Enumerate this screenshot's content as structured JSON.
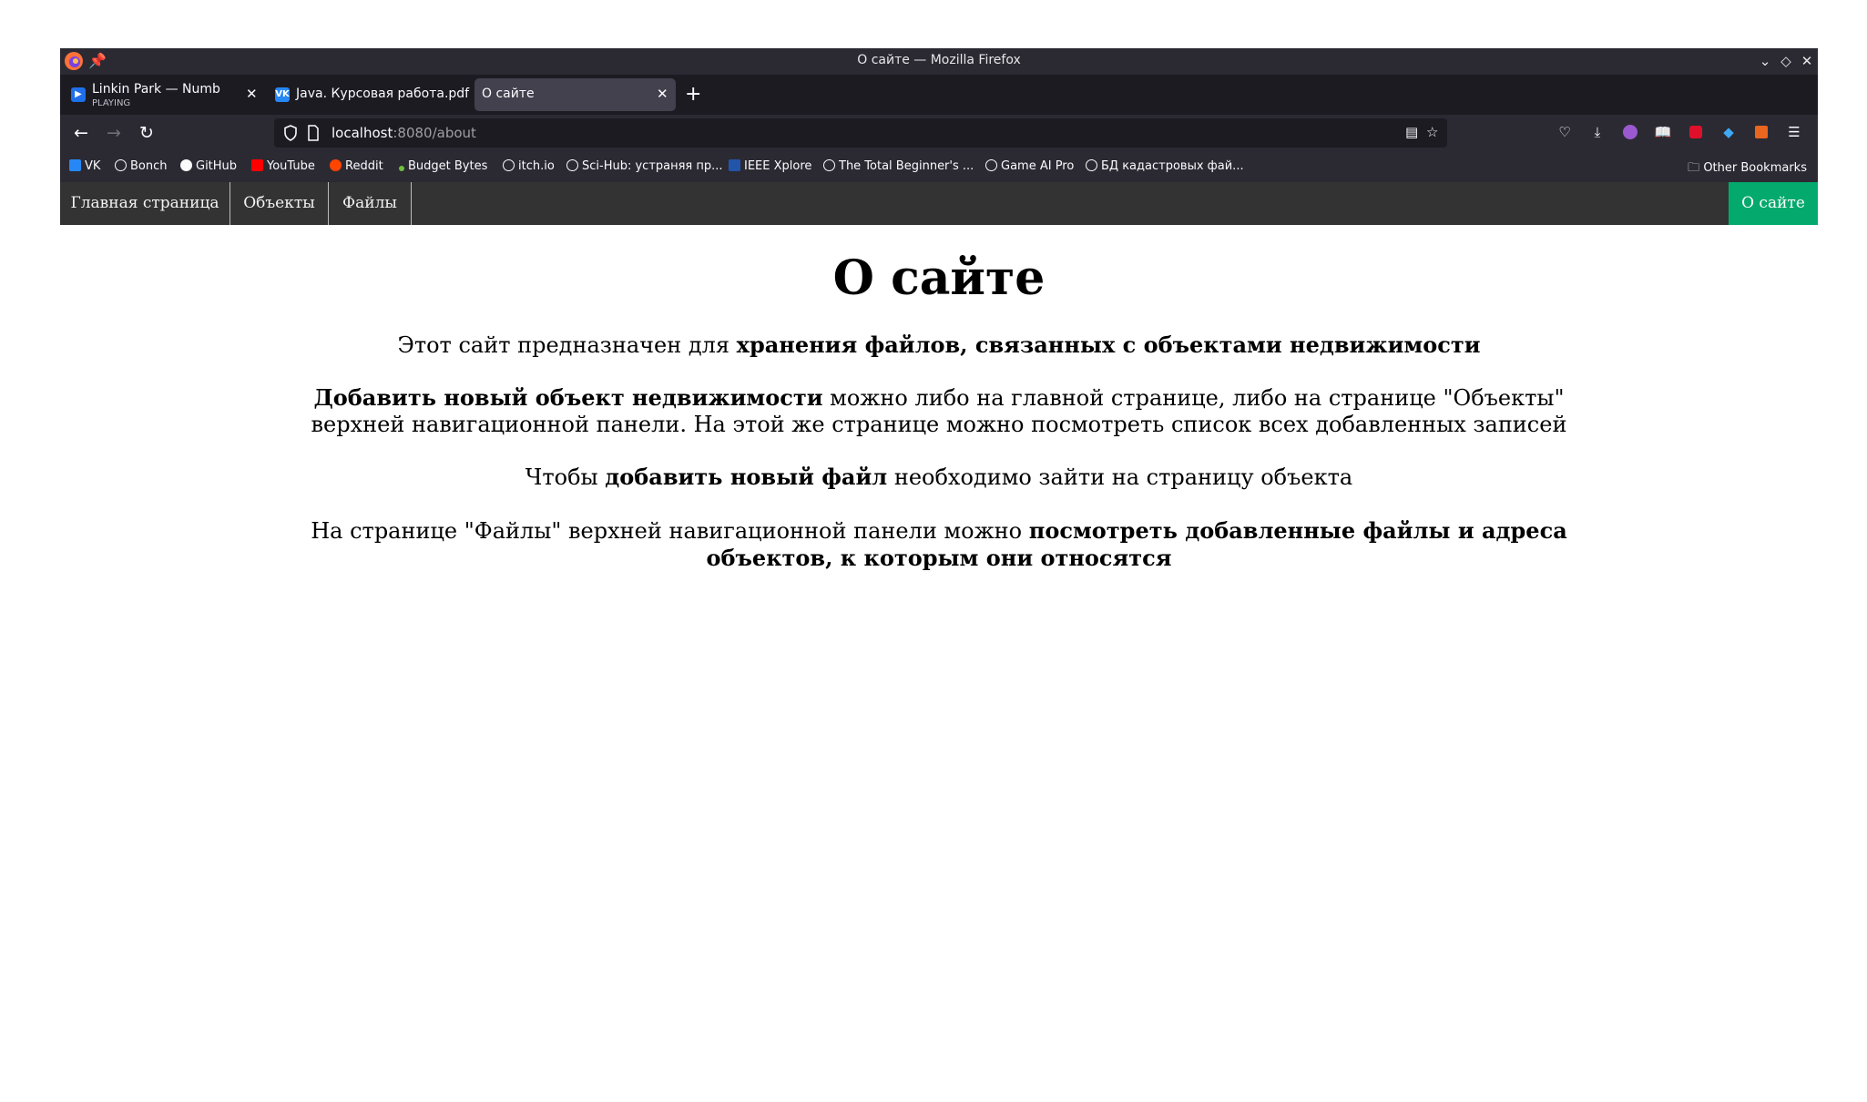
{
  "window": {
    "title": "О сайте — Mozilla Firefox"
  },
  "tabs": [
    {
      "label": "Linkin Park — Numb",
      "sub": "PLAYING"
    },
    {
      "label": "Java. Курсовая работа.pdf"
    },
    {
      "label": "О сайте"
    }
  ],
  "navbar": {
    "url_host": "localhost",
    "url_path": ":8080/about"
  },
  "bookmarks": [
    {
      "label": "VK",
      "icon": "vk-icon",
      "color": "#2787f5"
    },
    {
      "label": "Bonch",
      "icon": "globe-icon"
    },
    {
      "label": "GitHub",
      "icon": "github-icon"
    },
    {
      "label": "YouTube",
      "icon": "youtube-icon",
      "color": "#ff0000"
    },
    {
      "label": "Reddit",
      "icon": "reddit-icon",
      "color": "#ff4500"
    },
    {
      "label": "Budget Bytes",
      "icon": "budget-bytes-icon"
    },
    {
      "label": "itch.io",
      "icon": "globe-icon"
    },
    {
      "label": "Sci-Hub: устраняя пр...",
      "icon": "globe-icon"
    },
    {
      "label": "IEEE Xplore",
      "icon": "ieee-icon",
      "color": "#2255aa"
    },
    {
      "label": "The Total Beginner's ...",
      "icon": "globe-icon"
    },
    {
      "label": "Game AI Pro",
      "icon": "globe-icon"
    },
    {
      "label": "БД кадастровых фай...",
      "icon": "globe-icon"
    }
  ],
  "other_bookmarks": "Other Bookmarks",
  "site_nav": {
    "home": "Главная страница",
    "objects": "Объекты",
    "files": "Файлы",
    "about": "О сайте",
    "active_color": "#04aa6d"
  },
  "content": {
    "title": "О сайте",
    "p1_a": "Этот сайт предназначен для ",
    "p1_b": "хранения файлов, связанных с объектами недвижимости",
    "p2_a": "Добавить новый объект недвижимости",
    "p2_b": " можно либо на главной странице, либо на странице \"Объекты\" верхней навигационной панели. На этой же странице можно посмотреть список всех добавленных записей",
    "p3_a": "Чтобы ",
    "p3_b": "добавить новый файл",
    "p3_c": " необходимо зайти на страницу объекта",
    "p4_a": "На странице \"Файлы\" верхней навигационной панели можно ",
    "p4_b": "посмотреть добавленные файлы и адреса объектов, к которым они относятся"
  }
}
